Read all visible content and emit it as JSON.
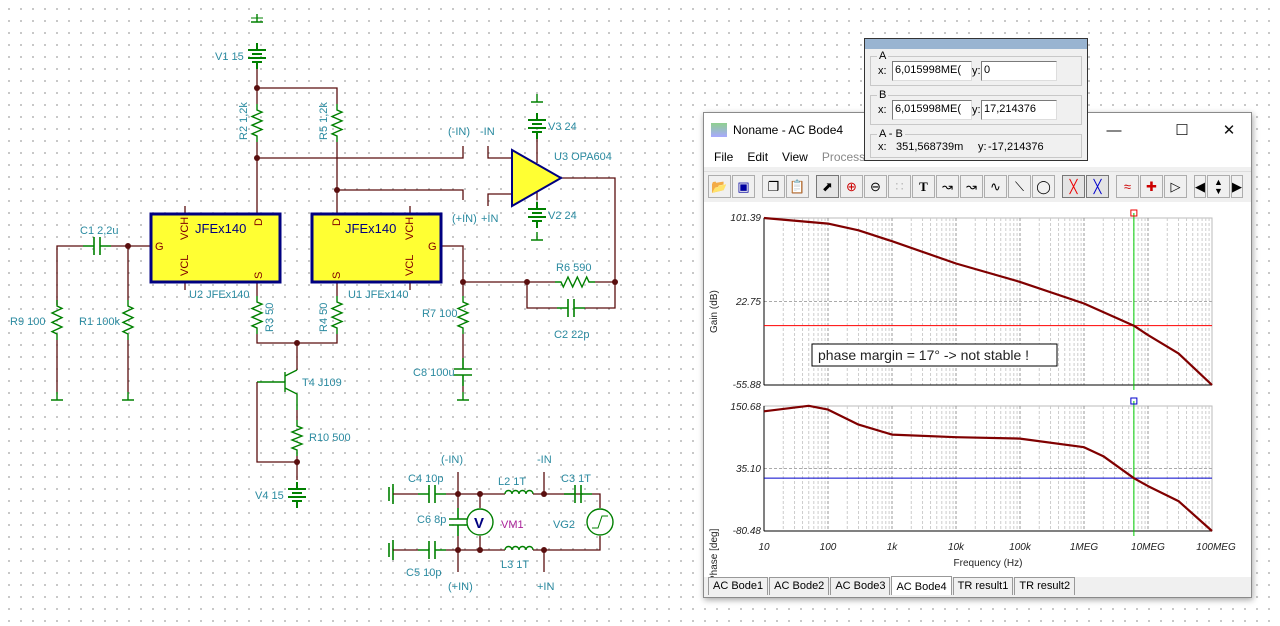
{
  "schematic": {
    "labels": [
      "V1 15",
      "R2 1,2k",
      "R5 1,2k",
      "(-IN)",
      "-IN",
      "(+IN)",
      "+IN",
      "U3 OPA604",
      "V3 24",
      "V2 24",
      "C1 2,2u",
      "JFEx140",
      "JFEx140",
      "U2 JFEx140",
      "U1 JFEx140",
      "R9 100",
      "R1 100k",
      "R3 50",
      "R4 50",
      "R7 100",
      "R6 590",
      "C2 22p",
      "C8 100u",
      "T4 J109",
      "R10 500",
      "V4 15",
      "C4 10p",
      "(-IN)",
      "L2 1T",
      "-IN",
      "C3 1T",
      "C6 8p",
      "VM1",
      "VG2",
      "C5 10p",
      "(+IN)",
      "L3 1T",
      "+IN"
    ],
    "pins": {
      "vch": "VCH",
      "vcl": "VCL",
      "d": "D",
      "s": "S",
      "g": "G"
    },
    "colors": {
      "wire": "#5a0f0f",
      "component": "#008000",
      "label": "#2a8aa0",
      "jfet_fill": "#ffff33",
      "jfet_border": "#000080"
    }
  },
  "window": {
    "title": "Noname - AC Bode4",
    "menu": [
      "File",
      "Edit",
      "View",
      "Process"
    ],
    "toolbar": [
      "open-icon",
      "save-icon",
      "copy-icon",
      "paste-icon",
      "pointer-icon",
      "zoom-in-icon",
      "zoom-100-icon",
      "grid-icon",
      "text-icon",
      "label-curve-icon",
      "question-curve-icon",
      "legend-icon",
      "line-icon",
      "ellipse-icon",
      "cursor-a-icon",
      "cursor-b-icon",
      "add-curve-icon",
      "add-probe-icon",
      "flag-icon",
      "left-icon",
      "up-down-icon",
      "right-icon"
    ],
    "tabs": [
      "AC Bode1",
      "AC Bode2",
      "AC Bode3",
      "AC Bode4",
      "TR result1",
      "TR result2"
    ],
    "active_tab": 3
  },
  "cursor_dialog": {
    "a": {
      "label": "A",
      "x_label": "x:",
      "x": "6,015998ME(",
      "y_label": "y:",
      "y": "0"
    },
    "b": {
      "label": "B",
      "x_label": "x:",
      "x": "6,015998ME(",
      "y_label": "y:",
      "y": "17,214376"
    },
    "diff": {
      "label": "A - B",
      "x_label": "x:",
      "x": "351,568739m",
      "y_label": "y:",
      "y": "-17,214376"
    }
  },
  "chart_data": [
    {
      "type": "line",
      "ylabel": "Gain (dB)",
      "xlabel": "",
      "xscale": "log",
      "xlim": [
        10,
        100000000
      ],
      "ylim": [
        -55.88,
        101.39
      ],
      "yticks": [
        "101.39",
        "22.75",
        "-55.88"
      ],
      "grid": true,
      "x": [
        10,
        100,
        300,
        1000,
        10000,
        100000,
        1000000,
        6015998,
        10000000,
        30000000,
        100000000
      ],
      "values": [
        101.39,
        96.1,
        89.8,
        79.5,
        58.5,
        41.2,
        20.9,
        0,
        -8.9,
        -26.1,
        -55.88
      ],
      "hline": 0,
      "cursor_x": 6015998,
      "annotation": "phase margin = 17° -> not stable !",
      "colors": {
        "curve": "#800000",
        "hline": "#ff0000",
        "cursor": "#00cc00"
      }
    },
    {
      "type": "line",
      "ylabel": "Phase [deg]",
      "xlabel": "Frequency (Hz)",
      "xscale": "log",
      "xlim": [
        10,
        100000000
      ],
      "ylim": [
        -80.48,
        150.68
      ],
      "yticks": [
        "150.68",
        "35.10",
        "-80.48"
      ],
      "xticks": [
        "10",
        "100",
        "1k",
        "10k",
        "100k",
        "1MEG",
        "10MEG",
        "100MEG"
      ],
      "grid": true,
      "x": [
        10,
        50,
        100,
        300,
        1000,
        10000,
        100000,
        1000000,
        2000000,
        6015998,
        10000000,
        30000000,
        100000000
      ],
      "values": [
        140.8,
        151,
        144,
        116.3,
        97.8,
        92.9,
        90.4,
        74.4,
        57.8,
        17.2,
        2.5,
        -25.2,
        -80.48
      ],
      "hline": 17.214376,
      "cursor_x": 6015998,
      "colors": {
        "curve": "#800000",
        "hline": "#0000cc",
        "cursor": "#00cc00"
      }
    }
  ]
}
